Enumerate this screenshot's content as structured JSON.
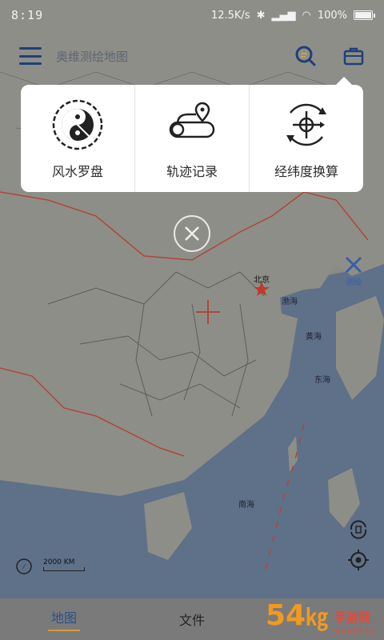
{
  "status": {
    "time": "8:19",
    "speed": "12.5K/s",
    "battery": "100%"
  },
  "header": {
    "title": "奥维测绘地图",
    "menu_icon": "hamburger-menu-icon",
    "search_icon": "search-map-icon",
    "toolbox_icon": "toolbox-icon"
  },
  "popup": {
    "tools": [
      {
        "label": "风水罗盘",
        "icon": "fengshui-compass-icon"
      },
      {
        "label": "轨迹记录",
        "icon": "track-record-icon"
      },
      {
        "label": "经纬度换算",
        "icon": "coordinate-convert-icon"
      }
    ]
  },
  "map": {
    "labels": {
      "beijing": "北京",
      "bohai": "渤海",
      "huanghai": "黄海",
      "donghai": "东海",
      "nanhai": "南海"
    },
    "side_button": "测绘",
    "scale": "2000 KM"
  },
  "nav": {
    "items": [
      {
        "label": "地图",
        "active": true
      },
      {
        "label": "文件",
        "active": false
      }
    ]
  },
  "watermark": {
    "text": "54㎏手游网",
    "subtext": "www.54.cn"
  },
  "colors": {
    "accent": "#1f3f7a",
    "tab_underline": "#d89a3a",
    "border_red": "#b0463a"
  }
}
